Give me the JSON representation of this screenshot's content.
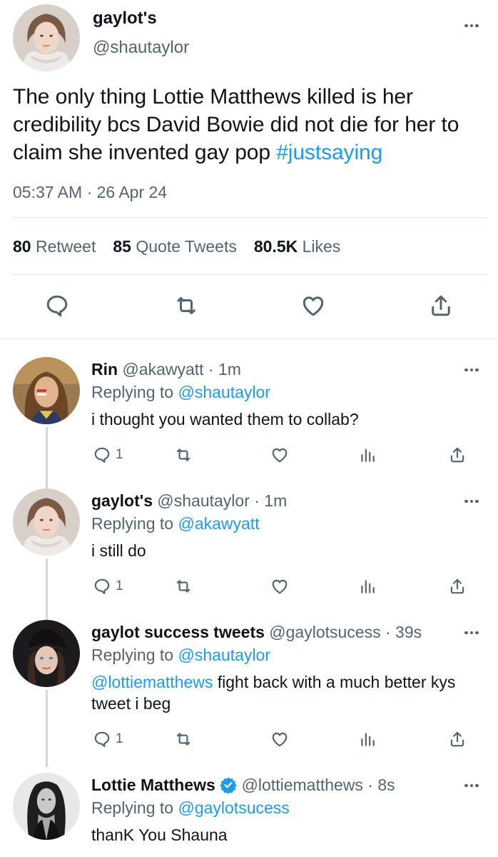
{
  "main_tweet": {
    "display_name": "gaylot's",
    "handle": "@shautaylor",
    "text": "The only thing Lottie Matthews killed is her credibility bcs David Bowie did not die for her to claim she invented gay pop ",
    "hashtag": "#justsaying",
    "timestamp": "05:37 AM · 26 Apr 24",
    "stats": {
      "retweets_count": "80",
      "retweets_label": "Retweet",
      "quotes_count": "85",
      "quotes_label": "Quote Tweets",
      "likes_count": "80.5K",
      "likes_label": "Likes"
    },
    "actions": [
      "reply-icon",
      "retweet-icon",
      "like-icon",
      "share-icon"
    ]
  },
  "replies": [
    {
      "display_name": "Rin",
      "handle_time": "@akawyatt · 1m",
      "replying_prefix": "Replying to ",
      "replying_to": "@shautaylor",
      "mention": "",
      "text": "i thought you wanted them to collab?",
      "reply_count": "1"
    },
    {
      "display_name": "gaylot's",
      "handle_time": "@shautaylor · 1m",
      "replying_prefix": "Replying to ",
      "replying_to": "@akawyatt",
      "mention": "",
      "text": "i still do",
      "reply_count": "1"
    },
    {
      "display_name": "gaylot success tweets",
      "handle_time": "@gaylotsucess · 39s",
      "replying_prefix": "Replying to ",
      "replying_to": "@shautaylor",
      "mention": "@lottiematthews",
      "text": " fight back with a much better kys tweet i beg",
      "reply_count": "1"
    },
    {
      "display_name": "Lottie Matthews",
      "handle_time": "@lottiematthews · 8s",
      "replying_prefix": "Replying to ",
      "replying_to": "@gaylotsucess",
      "mention": "",
      "text": "thanK You Shauna",
      "verified": true
    }
  ],
  "colors": {
    "link": "#1d9bf0",
    "secondary_text": "#536471",
    "primary_text": "#0f1419",
    "divider": "#e1e8ed",
    "thread_line": "#cfd9de",
    "verified": "#1d9bf0"
  }
}
